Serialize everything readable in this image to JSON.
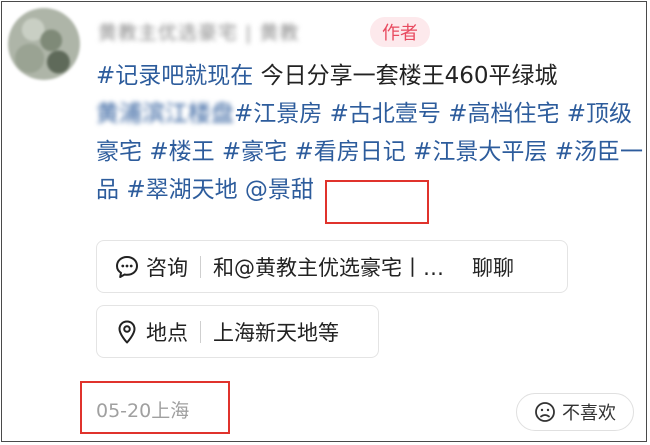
{
  "author": {
    "username": "黄教主优选豪宅 | 黄教",
    "badge": "作者"
  },
  "post": {
    "tag_record": "#记录吧就现在",
    "text_intro": " 今日分享一套楼王460平绿城",
    "blurred_text": "黄浦滨江楼盘",
    "tags": [
      "#江景房",
      "#古北壹号",
      "#高档住宅",
      "#顶级豪宅",
      "#楼王",
      "#豪宅",
      "#看房日记",
      "#江景大平层",
      "#汤臣一品",
      "#翠湖天地"
    ],
    "mention": "@景甜"
  },
  "consult": {
    "icon": "chat-bubble-icon",
    "label": "咨询",
    "value": "和@黄教主优选豪宅丨…",
    "action": "聊聊"
  },
  "location": {
    "icon": "location-pin-icon",
    "label": "地点",
    "value": "上海新天地等"
  },
  "footer": {
    "date_location": "05-20上海",
    "dislike_label": "不喜欢",
    "dislike_icon": "frown-face-icon"
  },
  "colors": {
    "tag": "#2d5c9c",
    "badge_bg": "#fde9ec",
    "badge_text": "#e84a5f",
    "highlight_box": "#e0332c",
    "muted_text": "#a0a0a0"
  }
}
